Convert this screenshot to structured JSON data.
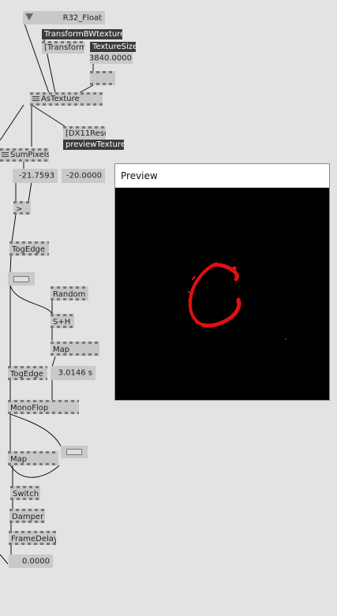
{
  "patch": {
    "r32_float": "R32_Float",
    "transform_bw_texture": "TransformBWtexture",
    "transform_partial": "[Transform",
    "texture_size": "TextureSize",
    "texture_size_value": "3840.0000",
    "as_texture": "AsTexture",
    "dx11_reso": "[DX11Reso",
    "preview_texture": "previewTexture",
    "sum_pixels": "SumPixels",
    "value_a": "-21.7593",
    "value_b": "-20.0000",
    "greater_than": ">",
    "togedge_1": "TogEdge",
    "random": "Random",
    "sample_hold": "S+H",
    "map_1": "Map",
    "togedge_2": "TogEdge",
    "duration_value": "3.0146 s",
    "monoflop": "MonoFlop",
    "map_2": "Map",
    "switch": "Switch",
    "damper": "Damper",
    "framedelay": "FrameDelay",
    "output_value": "0.0000"
  },
  "preview_window": {
    "title": "Preview"
  },
  "colors": {
    "canvas_bg": "#e3e3e3",
    "node_bg": "#c8c8c8",
    "dark_node_bg": "#3b3b3b",
    "preview_blob": "#e01010"
  }
}
